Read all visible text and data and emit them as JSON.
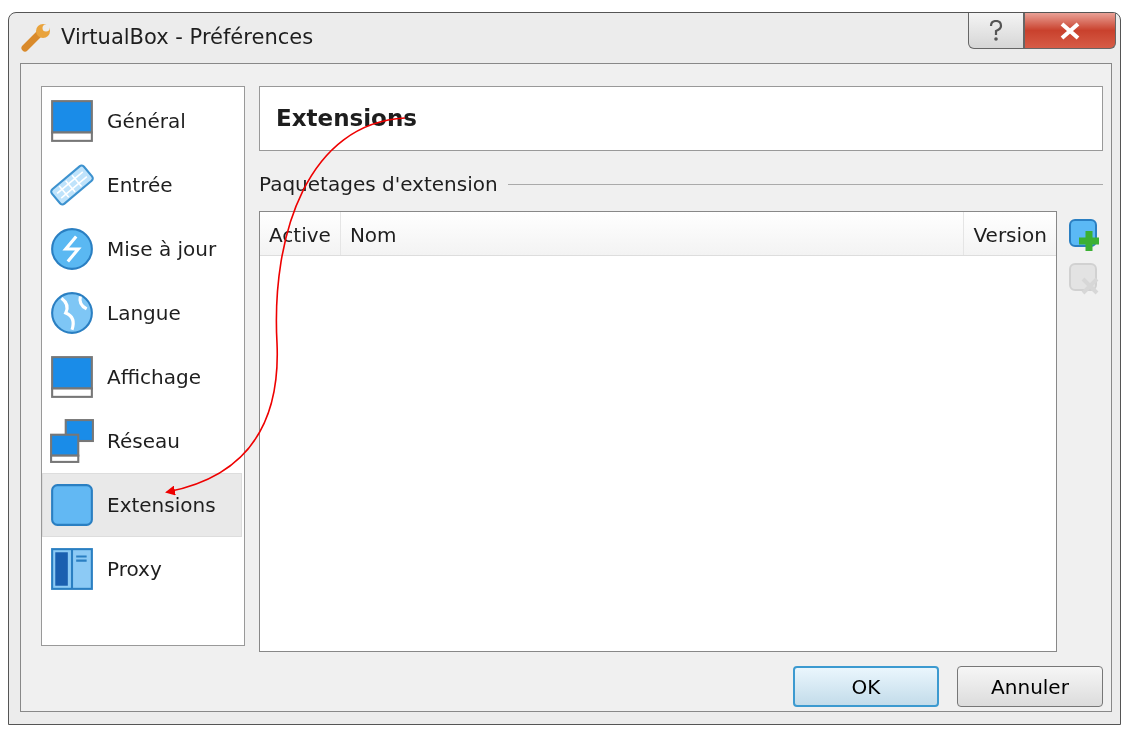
{
  "window": {
    "title": "VirtualBox - Préférences"
  },
  "sidebar": {
    "items": [
      {
        "label": "Général",
        "selected": false
      },
      {
        "label": "Entrée",
        "selected": false
      },
      {
        "label": "Mise à jour",
        "selected": false
      },
      {
        "label": "Langue",
        "selected": false
      },
      {
        "label": "Affichage",
        "selected": false
      },
      {
        "label": "Réseau",
        "selected": false
      },
      {
        "label": "Extensions",
        "selected": true
      },
      {
        "label": "Proxy",
        "selected": false
      }
    ]
  },
  "page": {
    "title": "Extensions",
    "group_label": "Paquetages d'extension"
  },
  "table": {
    "columns": [
      "Active",
      "Nom",
      "Version"
    ]
  },
  "side_tools": [
    {
      "kind": "add",
      "disabled": false
    },
    {
      "kind": "remove",
      "disabled": true
    }
  ],
  "buttons": [
    {
      "label": "OK",
      "default": true
    },
    {
      "label": "Annuler",
      "default": false
    }
  ]
}
